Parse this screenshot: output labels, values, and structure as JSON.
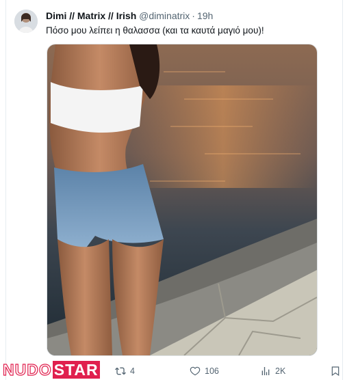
{
  "tweet": {
    "display_name": "Dimi // Matrix // Irish",
    "handle": "@diminatrix",
    "separator": "·",
    "time": "19h",
    "text": "Πόσο μου λείπει η θαλασσα (και τα καυτά μαγιό μου)!"
  },
  "actions": {
    "retweets": "4",
    "likes": "106",
    "views": "2K"
  },
  "watermark": {
    "part1": "NUDO",
    "part2": "STAR"
  },
  "icons": {
    "retweet": "retweet-icon",
    "like": "heart-icon",
    "views": "views-icon",
    "bookmark": "bookmark-icon"
  },
  "colors": {
    "text": "#0f1419",
    "muted": "#536471",
    "watermark": "#e0204e"
  }
}
